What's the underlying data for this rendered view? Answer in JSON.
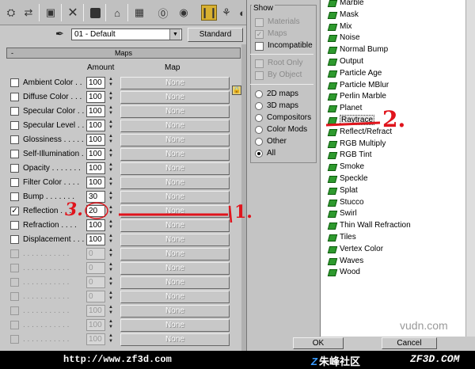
{
  "material": {
    "name": "01 - Default",
    "type_button": "Standard"
  },
  "maps_rollout": {
    "collapse_symbol": "-",
    "title": "Maps",
    "column_amount": "Amount",
    "column_map": "Map",
    "rows": [
      {
        "label": "Ambient Color . .",
        "checked": false,
        "amount": "100",
        "map": "None"
      },
      {
        "label": "Diffuse Color . . .",
        "checked": false,
        "amount": "100",
        "map": "None"
      },
      {
        "label": "Specular Color . .",
        "checked": false,
        "amount": "100",
        "map": "None"
      },
      {
        "label": "Specular Level . .",
        "checked": false,
        "amount": "100",
        "map": "None"
      },
      {
        "label": "Glossiness . . . . .",
        "checked": false,
        "amount": "100",
        "map": "None"
      },
      {
        "label": "Self-Illumination . .",
        "checked": false,
        "amount": "100",
        "map": "None"
      },
      {
        "label": "Opacity . . . . . . .",
        "checked": false,
        "amount": "100",
        "map": "None"
      },
      {
        "label": "Filter Color . . . .",
        "checked": false,
        "amount": "100",
        "map": "None"
      },
      {
        "label": "Bump . . . . . . .",
        "checked": false,
        "amount": "30",
        "map": "None"
      },
      {
        "label": "Reflection . . . .",
        "checked": true,
        "amount": "20",
        "map": "None"
      },
      {
        "label": "Refraction . . . .",
        "checked": false,
        "amount": "100",
        "map": "None"
      },
      {
        "label": "Displacement . . .",
        "checked": false,
        "amount": "100",
        "map": "None"
      },
      {
        "label": ". . . . . . . . . . .",
        "checked": false,
        "amount": "0",
        "map": "None",
        "disabled": true
      },
      {
        "label": ". . . . . . . . . . .",
        "checked": false,
        "amount": "0",
        "map": "None",
        "disabled": true
      },
      {
        "label": ". . . . . . . . . . .",
        "checked": false,
        "amount": "0",
        "map": "None",
        "disabled": true
      },
      {
        "label": ". . . . . . . . . . .",
        "checked": false,
        "amount": "0",
        "map": "None",
        "disabled": true
      },
      {
        "label": ". . . . . . . . . . .",
        "checked": false,
        "amount": "100",
        "map": "None",
        "disabled": true
      },
      {
        "label": ". . . . . . . . . . .",
        "checked": false,
        "amount": "100",
        "map": "None",
        "disabled": true
      },
      {
        "label": ". . . . . . . . . . .",
        "checked": false,
        "amount": "100",
        "map": "None",
        "disabled": true
      }
    ]
  },
  "show_group": {
    "label": "Show",
    "checks": [
      {
        "label": "Materials",
        "checked": false,
        "disabled": true
      },
      {
        "label": "Maps",
        "checked": true,
        "disabled": true
      },
      {
        "label": "Incompatible",
        "checked": false,
        "disabled": false
      }
    ],
    "checks2": [
      {
        "label": "Root Only",
        "checked": false,
        "disabled": true
      },
      {
        "label": "By Object",
        "checked": false,
        "disabled": true
      }
    ],
    "radios": [
      {
        "label": "2D maps",
        "selected": false
      },
      {
        "label": "3D maps",
        "selected": false
      },
      {
        "label": "Compositors",
        "selected": false
      },
      {
        "label": "Color Mods",
        "selected": false
      },
      {
        "label": "Other",
        "selected": false
      },
      {
        "label": "All",
        "selected": true
      }
    ]
  },
  "map_list": [
    {
      "name": "Marble"
    },
    {
      "name": "Mask"
    },
    {
      "name": "Mix"
    },
    {
      "name": "Noise"
    },
    {
      "name": "Normal Bump"
    },
    {
      "name": "Output"
    },
    {
      "name": "Particle Age"
    },
    {
      "name": "Particle MBlur"
    },
    {
      "name": "Perlin Marble"
    },
    {
      "name": "Planet"
    },
    {
      "name": "Raytrace",
      "selected": true
    },
    {
      "name": "Reflect/Refract"
    },
    {
      "name": "RGB Multiply"
    },
    {
      "name": "RGB Tint"
    },
    {
      "name": "Smoke"
    },
    {
      "name": "Speckle"
    },
    {
      "name": "Splat"
    },
    {
      "name": "Stucco"
    },
    {
      "name": "Swirl"
    },
    {
      "name": "Thin Wall Refraction"
    },
    {
      "name": "Tiles"
    },
    {
      "name": "Vertex Color"
    },
    {
      "name": "Waves"
    },
    {
      "name": "Wood"
    }
  ],
  "buttons": {
    "ok": "OK",
    "cancel": "Cancel"
  },
  "watermark": "vudn.com",
  "banner": {
    "url": "http://www.zf3d.com",
    "logo_mark": "Z",
    "logo_text": "朱峰社区",
    "brand": "ZF3D.COM"
  },
  "annotations": {
    "one": "1.",
    "two": "2.",
    "three": "3."
  },
  "colors": {
    "accent_highlight": "#d8b030",
    "map_icon": "#2e9a2e",
    "annotation": "#e0141c"
  },
  "icons": [
    "get-material-icon",
    "put-to-scene-icon",
    "assign-material-icon",
    "delete-icon",
    "make-unique-icon",
    "put-to-library-icon",
    "material-id-icon",
    "show-in-viewport-icon",
    "show-end-result-icon",
    "go-to-parent-icon",
    "go-forward-icon"
  ]
}
